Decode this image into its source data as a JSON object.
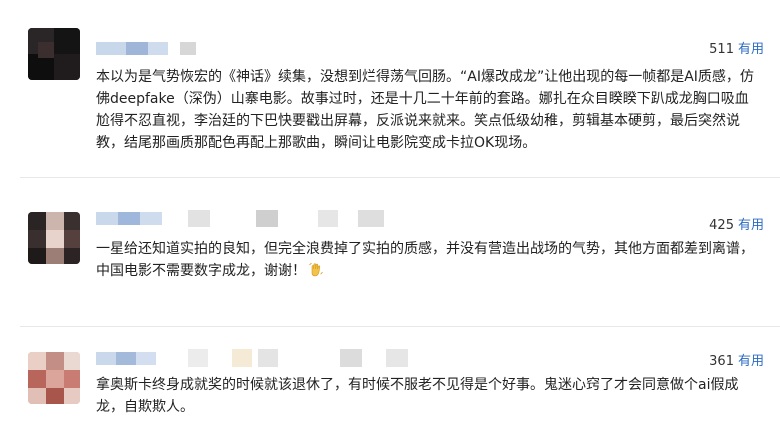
{
  "comments": [
    {
      "likes": "511",
      "like_label": "有用",
      "text": "本以为是气势恢宏的《神话》续集，没想到烂得荡气回肠。“AI爆改成龙”让他出现的每一帧都是AI质感，仿佛deepfake（深伪）山寨电影。故事过时，还是十几二十年前的套路。娜扎在众目睽睽下趴成龙胸口吸血尬得不忍直视，李治廷的下巴快要戳出屏幕，反派说来就来。笑点低级幼稚，剪辑基本硬剪，最后突然说教，结尾那画质那配色再配上那歌曲，瞬间让电影院变成卡拉OK现场。"
    },
    {
      "likes": "425",
      "like_label": "有用",
      "text": "一星给还知道实拍的良知，但完全浪费掉了实拍的质感，并没有营造出战场的气势，其他方面都差到离谱，中国电影不需要数字成龙，谢谢！",
      "emoji": "waving-hand-icon"
    },
    {
      "likes": "361",
      "like_label": "有用",
      "text": "拿奥斯卡终身成就奖的时候就该退休了，有时候不服老不见得是个好事。鬼迷心窍了才会同意做个ai假成龙，自欺欺人。"
    }
  ],
  "colors": {
    "link": "#2d6bc4",
    "text": "#222222",
    "divider": "#e8e8e8"
  }
}
